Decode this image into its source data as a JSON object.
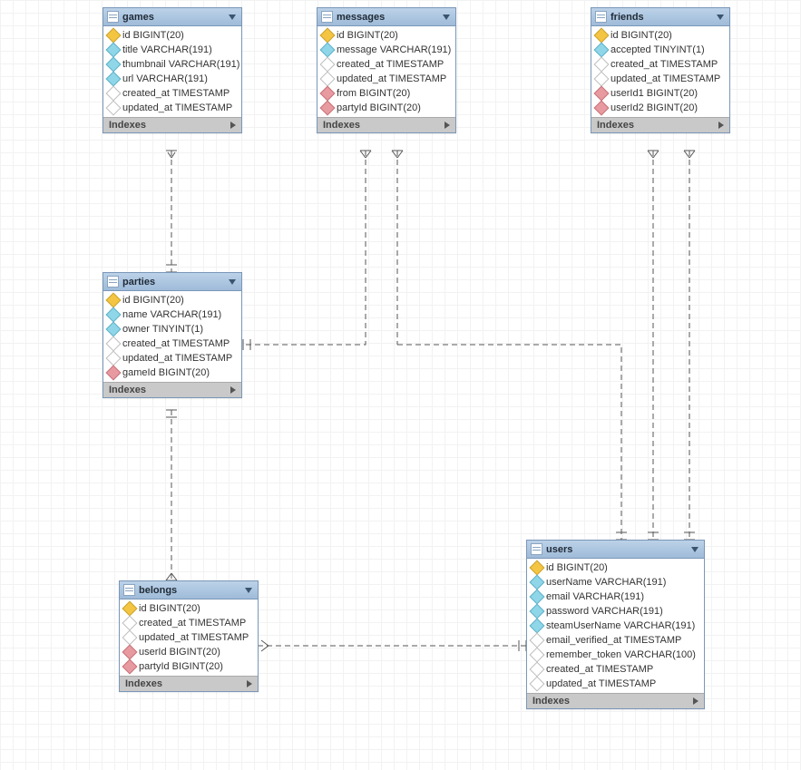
{
  "chart_data": {
    "type": "diagram",
    "title": "Database ER Diagram",
    "entities": [
      {
        "name": "games",
        "columns": [
          "id",
          "title",
          "thumbnail",
          "url",
          "created_at",
          "updated_at"
        ]
      },
      {
        "name": "messages",
        "columns": [
          "id",
          "message",
          "created_at",
          "updated_at",
          "from",
          "partyId"
        ]
      },
      {
        "name": "friends",
        "columns": [
          "id",
          "accepted",
          "created_at",
          "updated_at",
          "userId1",
          "userId2"
        ]
      },
      {
        "name": "parties",
        "columns": [
          "id",
          "name",
          "owner",
          "created_at",
          "updated_at",
          "gameId"
        ]
      },
      {
        "name": "belongs",
        "columns": [
          "id",
          "created_at",
          "updated_at",
          "userId",
          "partyId"
        ]
      },
      {
        "name": "users",
        "columns": [
          "id",
          "userName",
          "email",
          "password",
          "steamUserName",
          "email_verified_at",
          "remember_token",
          "created_at",
          "updated_at"
        ]
      }
    ],
    "relationships": [
      {
        "from": "parties.gameId",
        "to": "games.id",
        "type": "many-to-one"
      },
      {
        "from": "messages.partyId",
        "to": "parties.id",
        "type": "many-to-one"
      },
      {
        "from": "messages.from",
        "to": "users.id",
        "type": "many-to-one"
      },
      {
        "from": "friends.userId1",
        "to": "users.id",
        "type": "many-to-one"
      },
      {
        "from": "friends.userId2",
        "to": "users.id",
        "type": "many-to-one"
      },
      {
        "from": "belongs.partyId",
        "to": "parties.id",
        "type": "many-to-one"
      },
      {
        "from": "belongs.userId",
        "to": "users.id",
        "type": "many-to-one"
      }
    ]
  },
  "labels": {
    "indexes": "Indexes"
  },
  "tables": {
    "games": {
      "title": "games",
      "cols": {
        "id": "id BIGINT(20)",
        "title": "title VARCHAR(191)",
        "thumbnail": "thumbnail VARCHAR(191)",
        "url": "url VARCHAR(191)",
        "created_at": "created_at TIMESTAMP",
        "updated_at": "updated_at TIMESTAMP"
      }
    },
    "messages": {
      "title": "messages",
      "cols": {
        "id": "id BIGINT(20)",
        "message": "message VARCHAR(191)",
        "created_at": "created_at TIMESTAMP",
        "updated_at": "updated_at TIMESTAMP",
        "from": "from BIGINT(20)",
        "partyId": "partyId BIGINT(20)"
      }
    },
    "friends": {
      "title": "friends",
      "cols": {
        "id": "id BIGINT(20)",
        "accepted": "accepted TINYINT(1)",
        "created_at": "created_at TIMESTAMP",
        "updated_at": "updated_at TIMESTAMP",
        "userId1": "userId1 BIGINT(20)",
        "userId2": "userId2 BIGINT(20)"
      }
    },
    "parties": {
      "title": "parties",
      "cols": {
        "id": "id BIGINT(20)",
        "name": "name VARCHAR(191)",
        "owner": "owner TINYINT(1)",
        "created_at": "created_at TIMESTAMP",
        "updated_at": "updated_at TIMESTAMP",
        "gameId": "gameId BIGINT(20)"
      }
    },
    "belongs": {
      "title": "belongs",
      "cols": {
        "id": "id BIGINT(20)",
        "created_at": "created_at TIMESTAMP",
        "updated_at": "updated_at TIMESTAMP",
        "userId": "userId BIGINT(20)",
        "partyId": "partyId BIGINT(20)"
      }
    },
    "users": {
      "title": "users",
      "cols": {
        "id": "id BIGINT(20)",
        "userName": "userName VARCHAR(191)",
        "email": "email VARCHAR(191)",
        "password": "password VARCHAR(191)",
        "steamUserName": "steamUserName VARCHAR(191)",
        "email_verified_at": "email_verified_at TIMESTAMP",
        "remember_token": "remember_token VARCHAR(100)",
        "created_at": "created_at TIMESTAMP",
        "updated_at": "updated_at TIMESTAMP"
      }
    }
  }
}
